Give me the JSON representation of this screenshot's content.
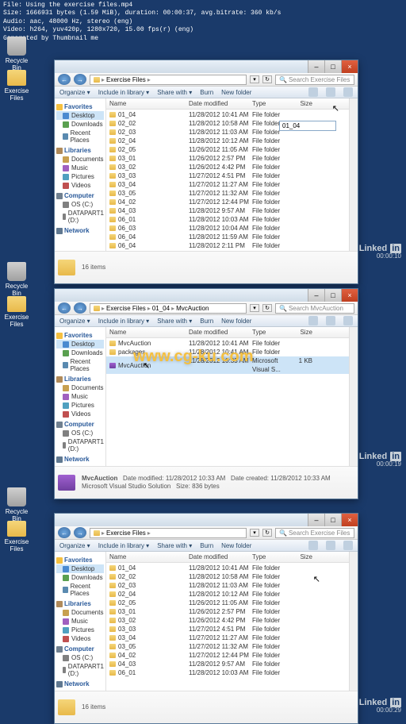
{
  "meta": {
    "l1": "File: Using the exercise files.mp4",
    "l2": "Size: 1666931 bytes (1.59 MiB), duration: 00:00:37, avg.bitrate: 360 kb/s",
    "l3": "Audio: aac, 48000 Hz, stereo (eng)",
    "l4": "Video: h264, yuv420p, 1280x720, 15.00 fps(r) (eng)",
    "l5": "Generated by Thumbnail me"
  },
  "desktop": {
    "recycle": "Recycle Bin",
    "exfiles": "Exercise Files"
  },
  "explorer": {
    "win_min": "–",
    "win_max": "□",
    "win_close": "×",
    "nav_back": "←",
    "nav_fwd": "→",
    "sep": "▸",
    "dropdown": "▾",
    "refresh": "↻",
    "search_icon": "🔍",
    "path1": [
      "Exercise Files"
    ],
    "path2": [
      "Exercise Files",
      "01_04",
      "MvcAuction"
    ],
    "search_ph1": "Search Exercise Files",
    "search_ph2": "Search MvcAuction",
    "tb": {
      "org": "Organize ▾",
      "inc": "Include in library ▾",
      "share": "Share with ▾",
      "burn": "Burn",
      "newf": "New folder"
    },
    "sidebar": {
      "fav": "Favorites",
      "desktop": "Desktop",
      "downloads": "Downloads",
      "recent": "Recent Places",
      "lib": "Libraries",
      "docs": "Documents",
      "music": "Music",
      "pics": "Pictures",
      "videos": "Videos",
      "comp": "Computer",
      "osc": "OS (C:)",
      "dp": "DATAPART1 (D:)",
      "net": "Network"
    },
    "cols": {
      "name": "Name",
      "date": "Date modified",
      "type": "Type",
      "size": "Size"
    },
    "rows1": [
      {
        "n": "01_04",
        "d": "11/28/2012 10:41 AM",
        "t": "File folder"
      },
      {
        "n": "02_02",
        "d": "11/28/2012 10:58 AM",
        "t": "File folder"
      },
      {
        "n": "02_03",
        "d": "11/28/2012 11:03 AM",
        "t": "File folder"
      },
      {
        "n": "02_04",
        "d": "11/28/2012 10:12 AM",
        "t": "File folder"
      },
      {
        "n": "02_05",
        "d": "11/26/2012 11:05 AM",
        "t": "File folder"
      },
      {
        "n": "03_01",
        "d": "11/26/2012 2:57 PM",
        "t": "File folder"
      },
      {
        "n": "03_02",
        "d": "11/26/2012 4:42 PM",
        "t": "File folder"
      },
      {
        "n": "03_03",
        "d": "11/27/2012 4:51 PM",
        "t": "File folder"
      },
      {
        "n": "03_04",
        "d": "11/27/2012 11:27 AM",
        "t": "File folder"
      },
      {
        "n": "03_05",
        "d": "11/27/2012 11:32 AM",
        "t": "File folder"
      },
      {
        "n": "04_02",
        "d": "11/27/2012 12:44 PM",
        "t": "File folder"
      },
      {
        "n": "04_03",
        "d": "11/28/2012 9:57 AM",
        "t": "File folder"
      },
      {
        "n": "06_01",
        "d": "11/28/2012 10:03 AM",
        "t": "File folder"
      },
      {
        "n": "06_03",
        "d": "11/28/2012 10:04 AM",
        "t": "File folder"
      },
      {
        "n": "06_04",
        "d": "11/28/2012 11:59 AM",
        "t": "File folder"
      },
      {
        "n": "06_04",
        "d": "11/28/2012 2:11 PM",
        "t": "File folder"
      }
    ],
    "rows2": [
      {
        "n": "MvcAuction",
        "d": "11/28/2012 10:41 AM",
        "t": "File folder",
        "s": ""
      },
      {
        "n": "packages",
        "d": "11/28/2012 10:41 AM",
        "t": "File folder",
        "s": ""
      },
      {
        "n": "MvcAuction",
        "d": "11/28/2012 10:33 AM",
        "t": "Microsoft Visual S...",
        "s": "1 KB",
        "sln": true,
        "sel": true
      }
    ],
    "ghost": "01_04",
    "detail1": {
      "count": "16 items"
    },
    "detail2": {
      "name": "MvcAuction",
      "type": "Microsoft Visual Studio Solution",
      "modlbl": "Date modified:",
      "mod": "11/28/2012 10:33 AM",
      "sizelbl": "Size:",
      "size": "836 bytes",
      "crlbl": "Date created:",
      "cr": "11/28/2012 10:33 AM"
    }
  },
  "branding": {
    "linked": "Linked",
    "in": "in",
    "ts1": "00:00:10",
    "ts2": "00:00:19",
    "ts3": "00:00:29"
  },
  "watermark": "www.cg-ku.com"
}
